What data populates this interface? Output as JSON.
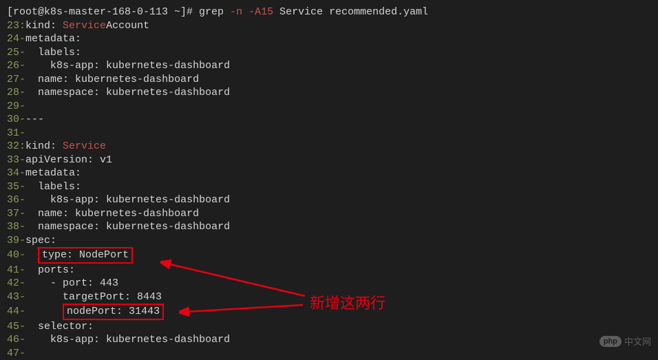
{
  "prompt": {
    "host": "[root@k8s-master-168-0-113 ~]# ",
    "command_base": "grep ",
    "command_opts": "-n -A15",
    "command_args": " Service recommended.yaml"
  },
  "lines": [
    {
      "num": "23",
      "sep": ":",
      "content": "kind: ",
      "highlight": "Service",
      "suffix": "Account"
    },
    {
      "num": "24",
      "sep": "-",
      "content": "metadata:"
    },
    {
      "num": "25",
      "sep": "-",
      "content": "  labels:"
    },
    {
      "num": "26",
      "sep": "-",
      "content": "    k8s-app: kubernetes-dashboard"
    },
    {
      "num": "27",
      "sep": "-",
      "content": "  name: kubernetes-dashboard"
    },
    {
      "num": "28",
      "sep": "-",
      "content": "  namespace: kubernetes-dashboard"
    },
    {
      "num": "29",
      "sep": "-",
      "content": ""
    },
    {
      "num": "30",
      "sep": "-",
      "content": "---"
    },
    {
      "num": "31",
      "sep": "-",
      "content": ""
    },
    {
      "num": "32",
      "sep": ":",
      "content": "kind: ",
      "highlight": "Service"
    },
    {
      "num": "33",
      "sep": "-",
      "content": "apiVersion: v1"
    },
    {
      "num": "34",
      "sep": "-",
      "content": "metadata:"
    },
    {
      "num": "35",
      "sep": "-",
      "content": "  labels:"
    },
    {
      "num": "36",
      "sep": "-",
      "content": "    k8s-app: kubernetes-dashboard"
    },
    {
      "num": "37",
      "sep": "-",
      "content": "  name: kubernetes-dashboard"
    },
    {
      "num": "38",
      "sep": "-",
      "content": "  namespace: kubernetes-dashboard"
    },
    {
      "num": "39",
      "sep": "-",
      "content": "spec:"
    },
    {
      "num": "40",
      "sep": "-",
      "content": "  ",
      "box": "type: NodePort"
    },
    {
      "num": "41",
      "sep": "-",
      "content": "  ports:"
    },
    {
      "num": "42",
      "sep": "-",
      "content": "    - port: 443"
    },
    {
      "num": "43",
      "sep": "-",
      "content": "      targetPort: 8443"
    },
    {
      "num": "44",
      "sep": "-",
      "content": "      ",
      "box": "nodePort: 31443"
    },
    {
      "num": "45",
      "sep": "-",
      "content": "  selector:"
    },
    {
      "num": "46",
      "sep": "-",
      "content": "    k8s-app: kubernetes-dashboard"
    },
    {
      "num": "47",
      "sep": "-",
      "content": ""
    }
  ],
  "annotation": {
    "text": "新增这两行"
  },
  "watermark": {
    "logo": "php",
    "text": "中文网"
  }
}
